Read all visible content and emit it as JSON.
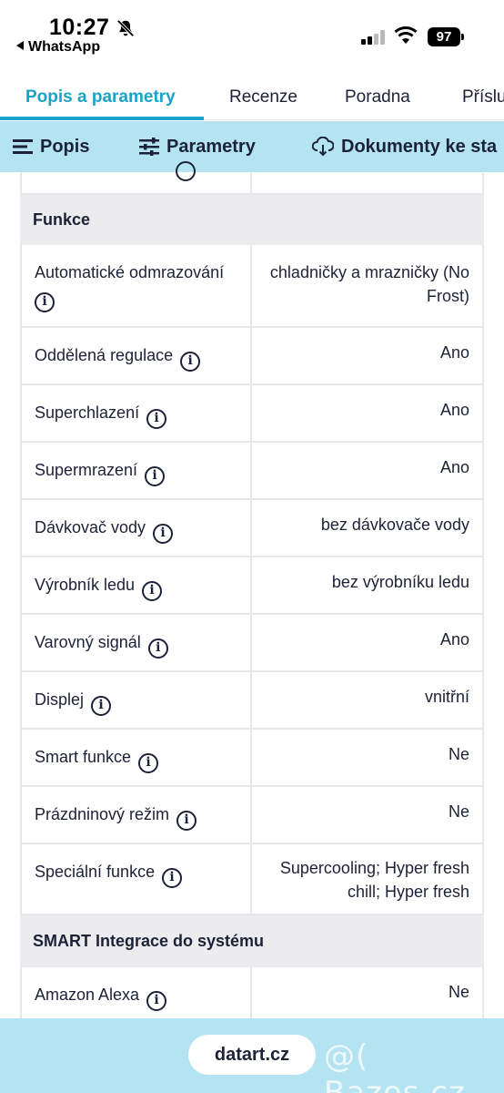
{
  "status": {
    "time": "10:27",
    "back_app": "WhatsApp",
    "battery": "97",
    "icons": [
      "bell-muted-icon",
      "signal-icon",
      "wifi-icon",
      "battery-icon"
    ]
  },
  "main_tabs": [
    {
      "label": "Popis a parametry",
      "active": true
    },
    {
      "label": "Recenze",
      "active": false
    },
    {
      "label": "Poradna",
      "active": false
    },
    {
      "label": "Příslu",
      "active": false
    }
  ],
  "sub_tabs": [
    {
      "label": "Popis",
      "icon": "menu-lines-icon"
    },
    {
      "label": "Parametry",
      "icon": "sliders-icon"
    },
    {
      "label": "Dokumenty ke sta",
      "icon": "cloud-download-icon"
    }
  ],
  "table": {
    "section_functions": "Funkce",
    "rows": [
      {
        "label": "Automatické odmrazování",
        "value": "chladničky a mrazničky (No Frost)"
      },
      {
        "label": "Oddělená regulace",
        "value": "Ano"
      },
      {
        "label": "Superchlazení",
        "value": "Ano"
      },
      {
        "label": "Supermrazení",
        "value": "Ano"
      },
      {
        "label": "Dávkovač vody",
        "value": "bez dávkovače vody"
      },
      {
        "label": "Výrobník ledu",
        "value": "bez výrobníku ledu"
      },
      {
        "label": "Varovný signál",
        "value": "Ano"
      },
      {
        "label": "Displej",
        "value": "vnitřní"
      },
      {
        "label": "Smart funkce",
        "value": "Ne"
      },
      {
        "label": "Prázdninový režim",
        "value": "Ne"
      },
      {
        "label": "Speciální funkce",
        "value": "Supercooling; Hyper fresh chill; Hyper fresh"
      }
    ],
    "section_smart": "SMART Integrace do systému",
    "smart_rows": [
      {
        "label": "Amazon Alexa",
        "value": "Ne"
      }
    ],
    "info_glyph": "i"
  },
  "bottom": {
    "url": "datart.cz",
    "watermark": "@( Bazos.cz"
  },
  "colors": {
    "accent": "#1aa3c9",
    "band": "#b4e4f1",
    "text": "#1c2237",
    "section_bg": "#ececee",
    "border": "#e6e7eb"
  }
}
